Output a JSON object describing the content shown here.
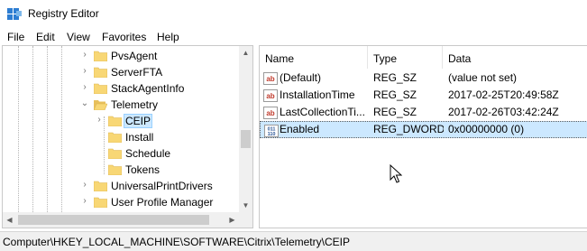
{
  "window": {
    "title": "Registry Editor",
    "icon": "registry-editor-icon"
  },
  "menu": [
    "File",
    "Edit",
    "View",
    "Favorites",
    "Help"
  ],
  "tree": {
    "items": [
      {
        "label": "PvsAgent",
        "expander": "collapsed"
      },
      {
        "label": "ServerFTA",
        "expander": "collapsed"
      },
      {
        "label": "StackAgentInfo",
        "expander": "collapsed"
      },
      {
        "label": "Telemetry",
        "expander": "expanded"
      },
      {
        "label": "CEIP",
        "expander": "collapsed",
        "selected": true
      },
      {
        "label": "Install",
        "expander": "none"
      },
      {
        "label": "Schedule",
        "expander": "none"
      },
      {
        "label": "Tokens",
        "expander": "none"
      },
      {
        "label": "UniversalPrintDrivers",
        "expander": "collapsed"
      },
      {
        "label": "User Profile Manager",
        "expander": "collapsed"
      }
    ]
  },
  "list": {
    "columns": [
      "Name",
      "Type",
      "Data"
    ],
    "rows": [
      {
        "icon": "string-value-icon",
        "name": "(Default)",
        "type": "REG_SZ",
        "data": "(value not set)"
      },
      {
        "icon": "string-value-icon",
        "name": "InstallationTime",
        "type": "REG_SZ",
        "data": "2017-02-25T20:49:58Z"
      },
      {
        "icon": "string-value-icon",
        "name": "LastCollectionTi...",
        "type": "REG_SZ",
        "data": "2017-02-26T03:42:24Z"
      },
      {
        "icon": "dword-value-icon",
        "name": "Enabled",
        "type": "REG_DWORD",
        "data": "0x00000000 (0)",
        "selected": true
      }
    ]
  },
  "status": {
    "path": "Computer\\HKEY_LOCAL_MACHINE\\SOFTWARE\\Citrix\\Telemetry\\CEIP"
  },
  "colors": {
    "selection": "#cce8ff",
    "folder": "#f8d775",
    "string_icon": "#c0392b",
    "dword_icon": "#2b5797"
  }
}
